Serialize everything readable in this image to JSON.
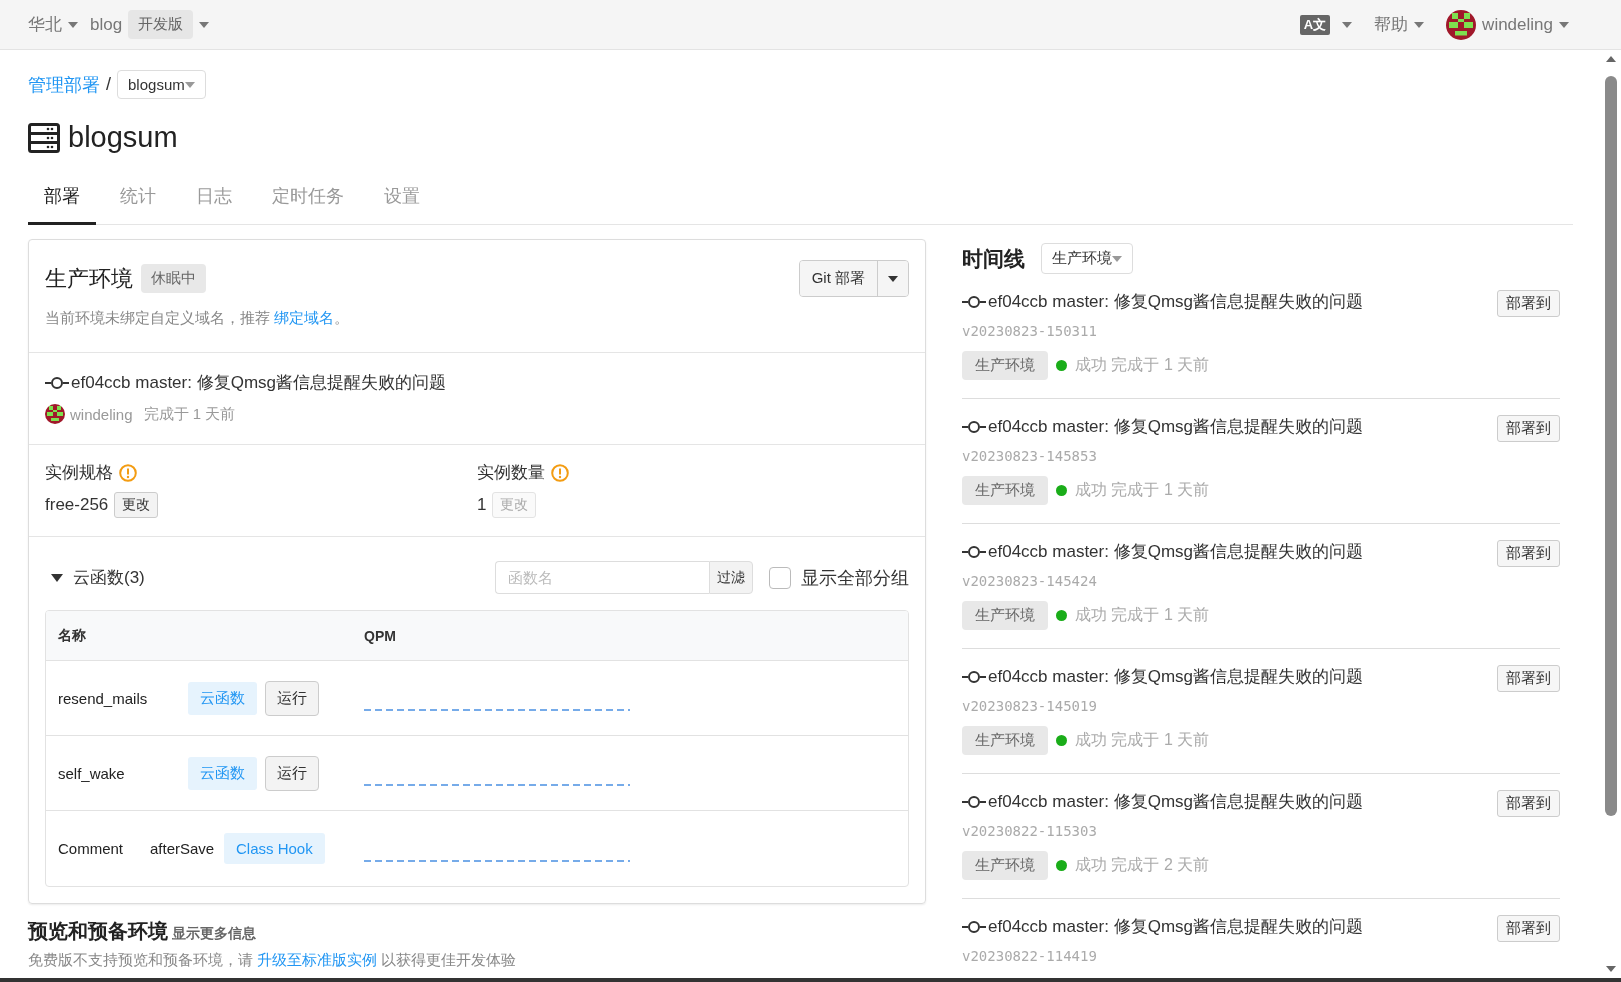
{
  "topbar": {
    "region": "华北",
    "app": "blog",
    "plan": "开发版",
    "language": "A文",
    "help": "帮助",
    "user": "windeling"
  },
  "breadcrumb": {
    "link": "管理部署",
    "separator": "/",
    "current": "blogsum"
  },
  "title": "blogsum",
  "tabs": [
    {
      "label": "部署",
      "selected": true
    },
    {
      "label": "统计",
      "selected": false
    },
    {
      "label": "日志",
      "selected": false
    },
    {
      "label": "定时任务",
      "selected": false
    },
    {
      "label": "设置",
      "selected": false
    }
  ],
  "environment": {
    "name": "生产环境",
    "status": "休眠中",
    "notice": "当前环境未绑定自定义域名，推荐 ",
    "notice_link": "绑定域名",
    "notice_end": "。",
    "deploy_button": "Git 部署",
    "commit": {
      "message": "ef04ccb master: 修复Qmsg酱信息提醒失败的问题",
      "author": "windeling",
      "finished": "完成于 1 天前"
    },
    "settings": [
      {
        "label": "实例规格",
        "value": "free-256",
        "action": "更改",
        "disabled": false
      },
      {
        "label": "实例数量",
        "value": "1",
        "action": "更改",
        "disabled": true
      }
    ]
  },
  "functions": {
    "title": "云函数(3)",
    "expanded": true,
    "filter_placeholder": "函数名",
    "filter_button": "过滤",
    "show_all_label": "显示全部分组",
    "show_all_checked": false,
    "columns": [
      "名称",
      "QPM"
    ],
    "rows": [
      {
        "kind": "function",
        "name": "resend_mails",
        "tag": "云函数",
        "action": "运行"
      },
      {
        "kind": "function",
        "name": "self_wake",
        "tag": "云函数",
        "action": "运行"
      },
      {
        "kind": "hook",
        "name": "Comment",
        "hook": "afterSave",
        "tag": "Class Hook"
      }
    ]
  },
  "preview": {
    "title": "预览和预备环境",
    "more": "显示更多信息",
    "notice": "免费版不支持预览和预备环境，请 ",
    "notice_link": "升级至标准版实例",
    "notice_end": " 以获得更佳开发体验"
  },
  "timeline": {
    "title": "时间线",
    "filter": "生产环境",
    "items": [
      {
        "message": "ef04ccb master: 修复Qmsg酱信息提醒失败的问题",
        "version": "v20230823-150311",
        "env": "生产环境",
        "color": "#1aad19",
        "status": "成功",
        "finished": "完成于 1 天前",
        "action": "部署到"
      },
      {
        "message": "ef04ccb master: 修复Qmsg酱信息提醒失败的问题",
        "version": "v20230823-145853",
        "env": "生产环境",
        "color": "#1aad19",
        "status": "成功",
        "finished": "完成于 1 天前",
        "action": "部署到"
      },
      {
        "message": "ef04ccb master: 修复Qmsg酱信息提醒失败的问题",
        "version": "v20230823-145424",
        "env": "生产环境",
        "color": "#1aad19",
        "status": "成功",
        "finished": "完成于 1 天前",
        "action": "部署到"
      },
      {
        "message": "ef04ccb master: 修复Qmsg酱信息提醒失败的问题",
        "version": "v20230823-145019",
        "env": "生产环境",
        "color": "#1aad19",
        "status": "成功",
        "finished": "完成于 1 天前",
        "action": "部署到"
      },
      {
        "message": "ef04ccb master: 修复Qmsg酱信息提醒失败的问题",
        "version": "v20230822-115303",
        "env": "生产环境",
        "color": "#1aad19",
        "status": "成功",
        "finished": "完成于 2 天前",
        "action": "部署到"
      },
      {
        "message": "ef04ccb master: 修复Qmsg酱信息提醒失败的问题",
        "version": "v20230822-114419",
        "action": "部署到"
      }
    ]
  }
}
